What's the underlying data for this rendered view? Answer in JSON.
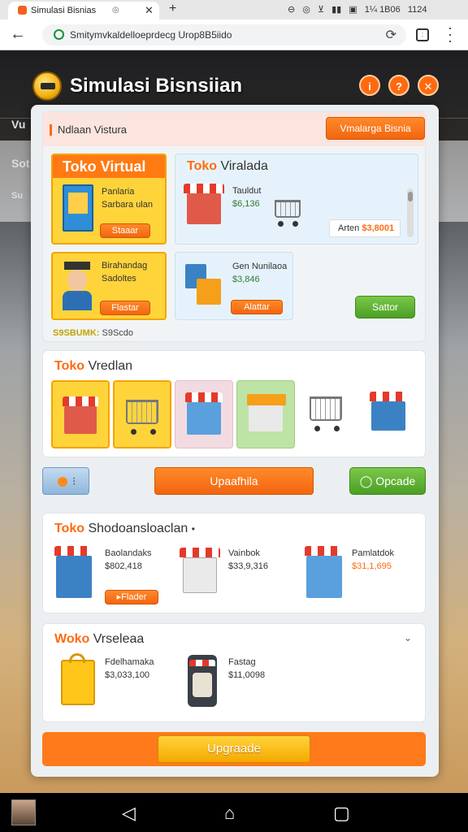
{
  "browser": {
    "tab_title": "Simulasi Bisnias",
    "tab_mute": "◎",
    "tab_close": "✕",
    "new_tab": "+",
    "url": "Smitymvkaldelloeprdecg Urop8B5iido",
    "status_icons": [
      "⊖",
      "◎",
      "⊻",
      "▮▮",
      "▣",
      "1¼ 1B06",
      "1124"
    ]
  },
  "game": {
    "title": "Simulasi Bisnsiian",
    "header_buttons": [
      "i",
      "?",
      "✕"
    ],
    "background_labels": [
      "Vu",
      "Sot",
      "Su"
    ]
  },
  "section1": {
    "heading": "Ndlaan Vistura",
    "top_button": "Vmalarga Bisnia",
    "virtual_card": {
      "title": "Toko Virtual",
      "desc1": "Panlaria",
      "desc2": "Sarbara ulan",
      "button": "Staaar"
    },
    "virtual_card2": {
      "title_accent": "Toko",
      "title_rest": "Viralada",
      "line1": "Tauldut",
      "price": "$6,136",
      "price_label": "Arten",
      "price_value": "$3,8001"
    },
    "profile_card": {
      "line1": "Birahandag",
      "line2": "Sadoltes",
      "button": "Flastar"
    },
    "profile_card2": {
      "line1": "Gen Nunilaoa",
      "price": "$3,846",
      "button": "Alattar"
    },
    "green_button": "Sattor",
    "footer_accent": "S9SBUMK:",
    "footer_rest": "S9Scdo"
  },
  "section2": {
    "title_accent": "Toko",
    "title_rest": "Vredlan"
  },
  "row3": {
    "center_button": "Upaafhila",
    "green_button": "Opcade",
    "green_icon": "◯"
  },
  "section3": {
    "title_accent": "Toko",
    "title_rest": "Shodoansloaclan",
    "title_mark": "•",
    "items": [
      {
        "name": "Baolandaks",
        "price": "$802,418"
      },
      {
        "name": "Vainbok",
        "price": "$33,9,316"
      },
      {
        "name": "Pamlatdok",
        "price": "$31,1,695"
      }
    ],
    "item_button": "Flader"
  },
  "section4": {
    "title_accent": "Woko",
    "title_rest": "Vrseleaa",
    "chevron": "⌄",
    "items": [
      {
        "name": "Fdelhamaka",
        "price": "$3,033,100"
      },
      {
        "name": "Fastag",
        "price": "$11,0098"
      }
    ]
  },
  "bottom": {
    "upgrade": "Upgraade"
  },
  "nav": {
    "back": "◁",
    "home": "⌂",
    "recents": "▢"
  }
}
